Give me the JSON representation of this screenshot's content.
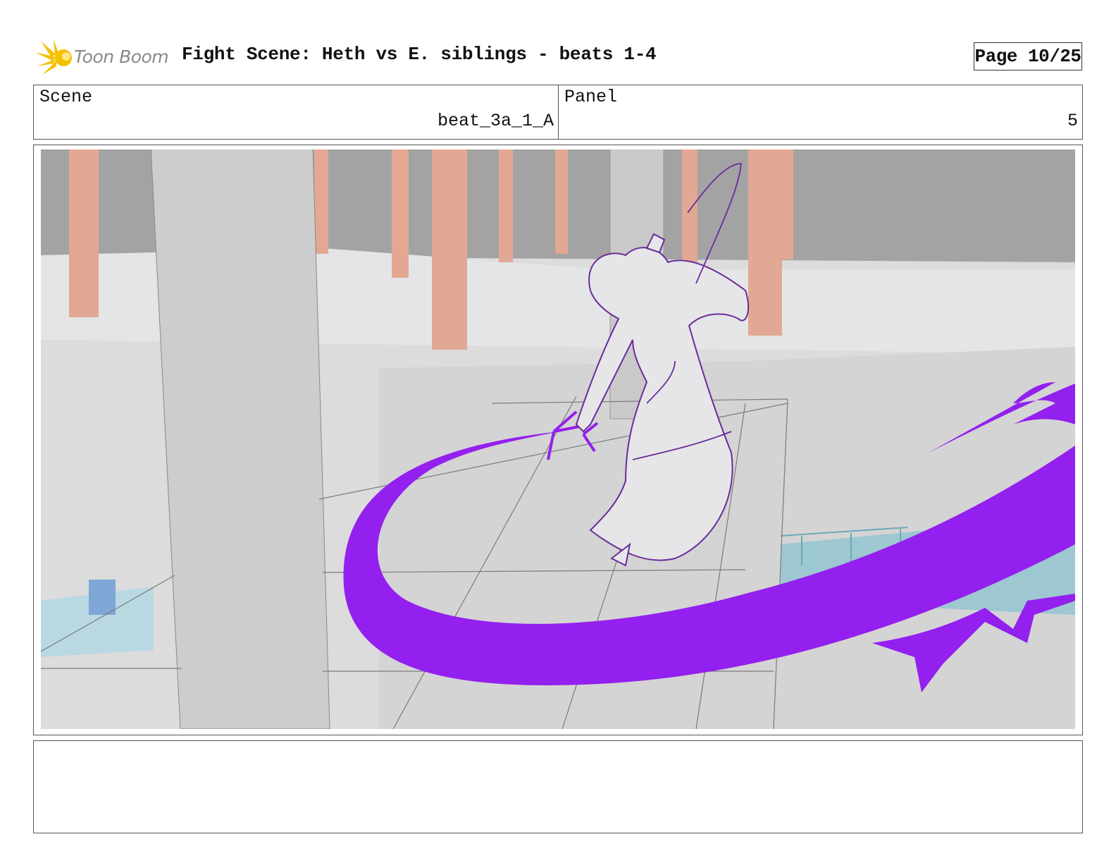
{
  "logo": {
    "text": "Toon Boom",
    "icon": "starburst-logo-icon",
    "color": "#f5c000"
  },
  "document_title": "Fight Scene: Heth vs E. siblings - beats 1-4",
  "page": "Page 10/25",
  "scene": {
    "label": "Scene",
    "value": "beat_3a_1_A"
  },
  "panel": {
    "label": "Panel",
    "value": "5"
  },
  "artwork": {
    "description_icon": "storyboard-panel-image",
    "colors": {
      "magic_trail": "#9320ee",
      "sketch_line": "#6a2c9a",
      "pillars": "#e2a893",
      "backdrop": "#a3a3a3",
      "water": "#8ec3cf"
    }
  },
  "notes": {
    "text": ""
  }
}
